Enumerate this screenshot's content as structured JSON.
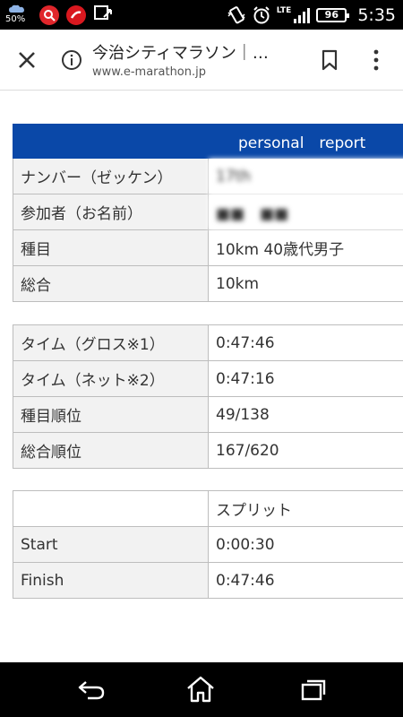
{
  "status_bar": {
    "battery_saver_percent": "50%",
    "network_label": "LTE",
    "battery_percent": "96",
    "time": "5:35"
  },
  "browser": {
    "page_title": "今治シティマラソン｜…",
    "url": "www.e-marathon.jp"
  },
  "report": {
    "header": "personal　report",
    "profile_rows": [
      {
        "label": "ナンバー（ゼッケン）",
        "value": "17th"
      },
      {
        "label": "参加者（お名前）",
        "value": "■■　■■"
      },
      {
        "label": "種目",
        "value": "10km 40歳代男子"
      },
      {
        "label": "総合",
        "value": "10km"
      }
    ],
    "result_rows": [
      {
        "label": "タイム（グロス※1）",
        "value": "0:47:46"
      },
      {
        "label": "タイム（ネット※2）",
        "value": "0:47:16"
      },
      {
        "label": "種目順位",
        "value": "49/138"
      },
      {
        "label": "総合順位",
        "value": "167/620"
      }
    ],
    "split": {
      "header_label": "",
      "header_value": "スプリット",
      "rows": [
        {
          "label": "Start",
          "value": "0:00:30"
        },
        {
          "label": "Finish",
          "value": "0:47:46"
        }
      ]
    }
  }
}
